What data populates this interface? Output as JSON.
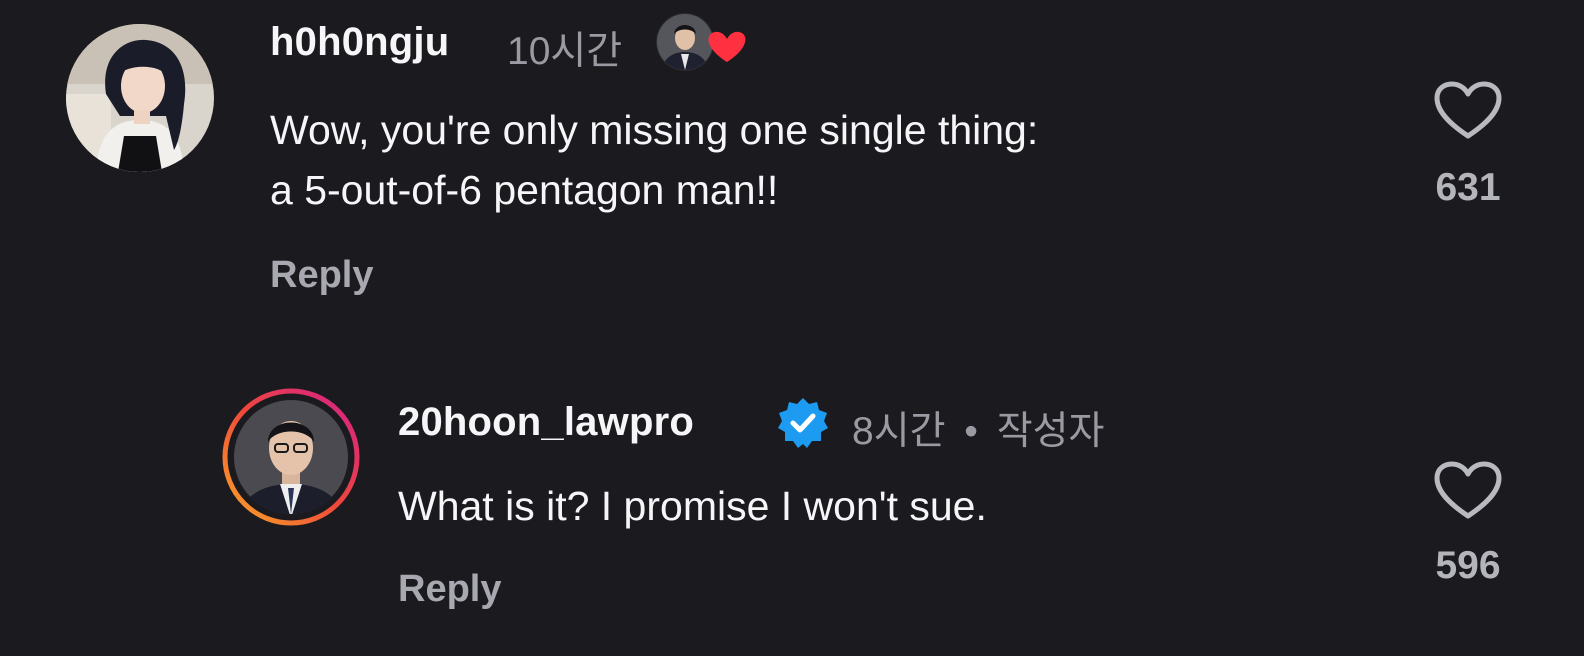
{
  "comments": [
    {
      "username": "h0h0ngju",
      "time": "10시간",
      "text_lines": [
        "Wow, you're only missing one single thing:",
        "a 5-out-of-6 pentagon man!!"
      ],
      "reply_label": "Reply",
      "like_count": "631",
      "liked_by_author": true,
      "avatar_icon": "avatar-photo-woman"
    },
    {
      "username": "20hoon_lawpro",
      "verified": true,
      "time": "8시간",
      "separator": "•",
      "author_badge": "작성자",
      "text_lines": [
        "What is it? I promise I won't sue."
      ],
      "reply_label": "Reply",
      "like_count": "596",
      "avatar_icon": "avatar-photo-man-story-ring"
    }
  ],
  "colors": {
    "background": "#1b1b1f",
    "verified": "#1d9bf0",
    "heart_red": "#ff3040",
    "story_ring_start": "#f9a825",
    "story_ring_end": "#d3208c"
  }
}
